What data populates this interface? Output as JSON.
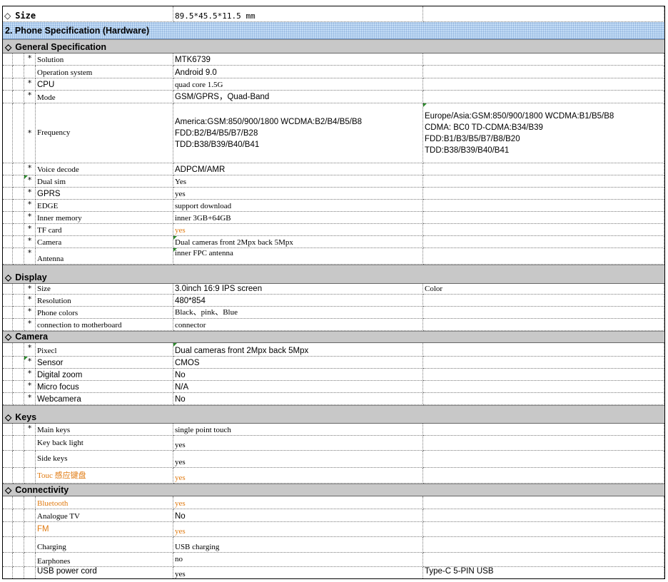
{
  "top_row": {
    "label": "Size",
    "value": "89.5*45.5*11.5 mm"
  },
  "hardware_title": "2. Phone Specification (Hardware)",
  "sections": {
    "general": {
      "title": "General Specification",
      "rows": [
        {
          "star": "*",
          "label": "Solution",
          "value": "MTK6739",
          "note": ""
        },
        {
          "star": "",
          "label": "Operation system",
          "value": "Android 9.0",
          "note": ""
        },
        {
          "star": "*",
          "label": "CPU",
          "value": "quad core 1.5G",
          "note": ""
        },
        {
          "star": "*",
          "label": "Mode",
          "value": "GSM/GPRS，Quad-Band",
          "note": ""
        },
        {
          "star": "*",
          "label": "Frequency",
          "value_lines": [
            "America:GSM:850/900/1800    WCDMA:B2/B4/B5/B8",
            "FDD:B2/B4/B5/B7/B28",
            "TDD:B38/B39/B40/B41"
          ],
          "note_lines": [
            "Europe/Asia:GSM:850/900/1800    WCDMA:B1/B5/B8",
            "CDMA: BC0  TD-CDMA:B34/B39",
            "FDD:B1/B3/B5/B7/B8/B20",
            "TDD:B38/B39/B40/B41"
          ]
        },
        {
          "star": "*",
          "label": "Voice decode",
          "value": "ADPCM/AMR",
          "note": ""
        },
        {
          "star": "*",
          "label": "Dual sim",
          "value": "Yes",
          "note": ""
        },
        {
          "star": "*",
          "label": "GPRS",
          "value": "yes",
          "note": ""
        },
        {
          "star": "*",
          "label": "EDGE",
          "value": "support download",
          "note": ""
        },
        {
          "star": "*",
          "label": "Inner memory",
          "value": "inner 3GB+64GB",
          "note": ""
        },
        {
          "star": "*",
          "label": "TF card",
          "value": "yes",
          "note": ""
        },
        {
          "star": "*",
          "label": "Camera",
          "value": "Dual cameras front 2Mpx back 5Mpx",
          "note": ""
        },
        {
          "star": "*",
          "label": "Antenna",
          "value": "inner FPC antenna",
          "note": ""
        }
      ]
    },
    "display": {
      "title": "Display",
      "rows": [
        {
          "star": "*",
          "label": "Size",
          "value": "3.0inch 16:9  IPS screen",
          "note": "Color"
        },
        {
          "star": "*",
          "label": "Resolution",
          "value": "480*854",
          "note": ""
        },
        {
          "star": "*",
          "label": "Phone colors",
          "value": "Black、pink、Blue",
          "note": ""
        },
        {
          "star": "*",
          "label": "connection to motherboard",
          "value": "connector",
          "note": ""
        }
      ]
    },
    "camera": {
      "title": "Camera",
      "rows": [
        {
          "star": "*",
          "label": "Pixecl",
          "value": "Dual cameras front 2Mpx back 5Mpx",
          "note": ""
        },
        {
          "star": "*",
          "label": "Sensor",
          "value": "CMOS",
          "note": ""
        },
        {
          "star": "*",
          "label": "Digital zoom",
          "value": "No",
          "note": ""
        },
        {
          "star": "*",
          "label": "Micro focus",
          "value": "N/A",
          "note": ""
        },
        {
          "star": "*",
          "label": "Webcamera",
          "value": "No",
          "note": ""
        }
      ]
    },
    "keys": {
      "title": "Keys",
      "rows": [
        {
          "star": "*",
          "label": "Main keys",
          "value": "single point touch",
          "note": ""
        },
        {
          "star": "",
          "label": "Key back light",
          "value": "yes",
          "note": ""
        },
        {
          "star": "",
          "label": "Side keys",
          "value": "yes",
          "note": ""
        },
        {
          "star": "",
          "label": "Touc 感应键盘",
          "value": "yes",
          "note": ""
        }
      ]
    },
    "connectivity": {
      "title": "Connectivity",
      "rows": [
        {
          "star": "",
          "label": "Bluetooth",
          "value": "yes",
          "note": ""
        },
        {
          "star": "",
          "label": "Analogue TV",
          "value": "No",
          "note": ""
        },
        {
          "star": "",
          "label": "FM",
          "value": "yes",
          "note": ""
        },
        {
          "star": "",
          "label": "Charging",
          "value": "USB charging",
          "note": ""
        },
        {
          "star": "",
          "label": "Earphones",
          "value": "no",
          "note": ""
        },
        {
          "star": "",
          "label": "USB power cord",
          "value": "yes",
          "note": "Type-C 5-PIN USB"
        }
      ]
    }
  },
  "colors": {
    "section_bg": "#c8c8c8",
    "hardware_bg": "#c3dcf6",
    "highlight": "#e07a10",
    "marker": "#2a8a2a"
  }
}
